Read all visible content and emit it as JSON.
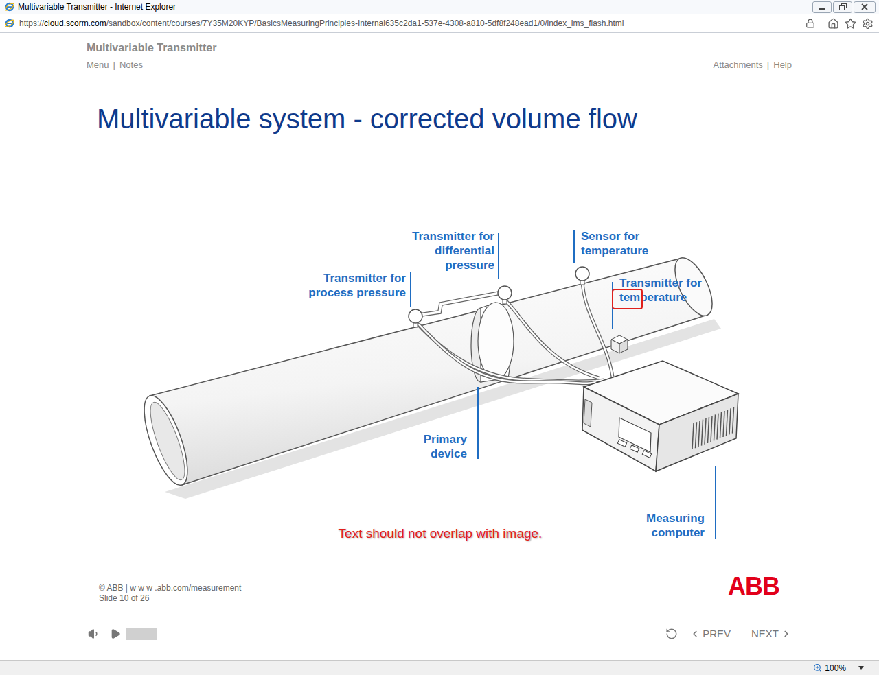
{
  "window": {
    "title": "Multivariable Transmitter - Internet Explorer"
  },
  "address_bar": {
    "scheme": "https://",
    "host": "cloud.scorm.com",
    "path": "/sandbox/content/courses/7Y35M20KYP/BasicsMeasuringPrinciples-Internal635c2da1-537e-4308-a810-5df8f248ead1/0/index_lms_flash.html"
  },
  "course": {
    "title": "Multivariable Transmitter",
    "nav_left": [
      "Menu",
      "Notes"
    ],
    "nav_right": [
      "Attachments",
      "Help"
    ],
    "separator": "|"
  },
  "slide": {
    "heading": "Multivariable system - corrected volume flow",
    "labels": [
      {
        "lines": [
          "Transmitter for",
          "process pressure"
        ]
      },
      {
        "lines": [
          "Transmitter for",
          "differential",
          "pressure"
        ]
      },
      {
        "lines": [
          "Sensor for",
          "temperature"
        ]
      },
      {
        "lines": [
          "Transmitter for",
          "temperature"
        ]
      },
      {
        "lines": [
          "Primary",
          "device"
        ]
      },
      {
        "lines": [
          "Measuring",
          "computer"
        ]
      }
    ],
    "annotation": "Text should not overlap with image."
  },
  "footer": {
    "copyright": "© ABB | w w w .abb.com/measurement",
    "slide_counter": "Slide 10 of 26",
    "logo": "ABB"
  },
  "player": {
    "playing": false,
    "prev": "PREV",
    "next": "NEXT"
  },
  "status_bar": {
    "zoom": "100%"
  }
}
